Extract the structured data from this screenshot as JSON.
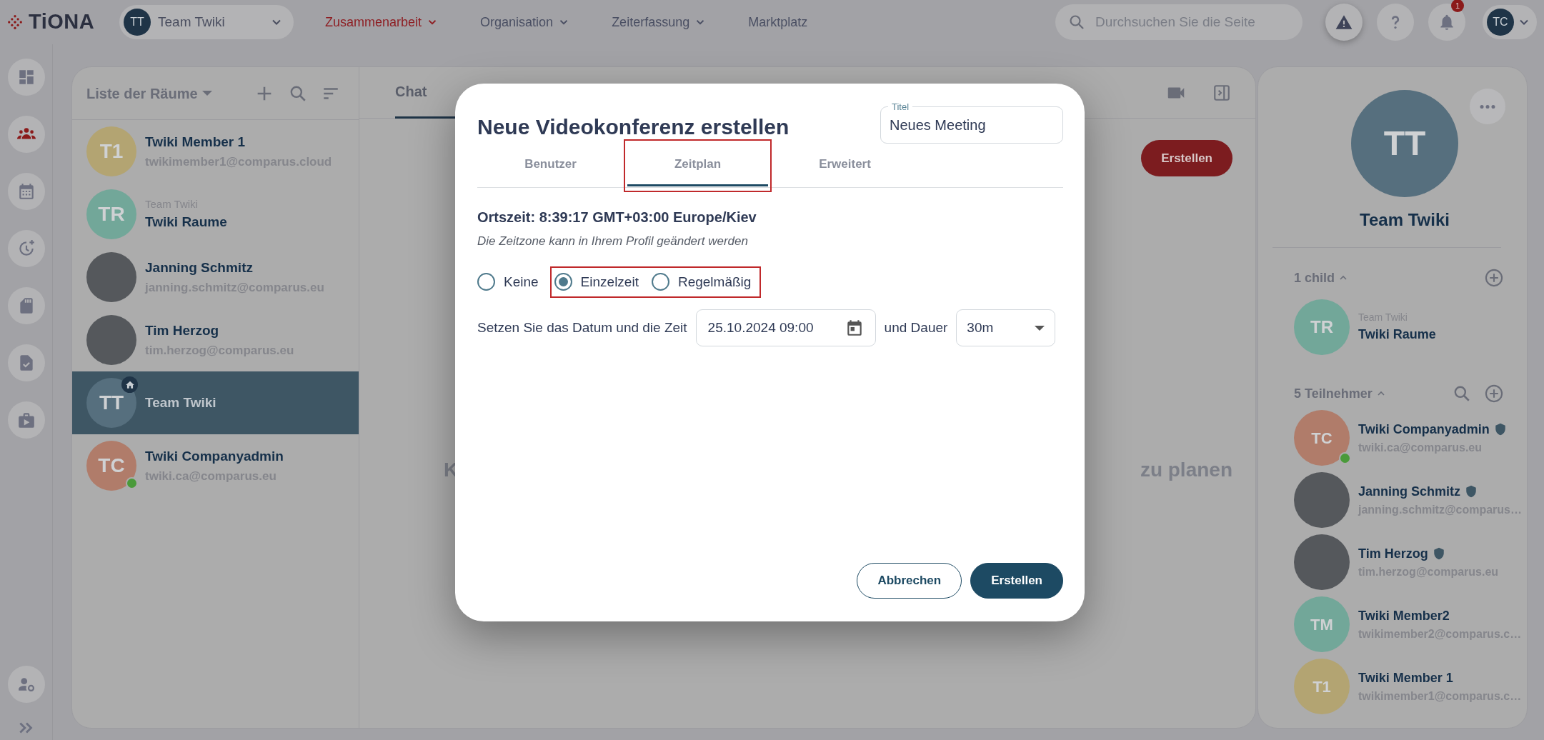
{
  "top_bar": {
    "logo": "TiONA",
    "team_selector": {
      "initials": "TT",
      "name": "Team Twiki"
    },
    "nav": [
      {
        "label": "Zusammenarbeit",
        "selected": true,
        "dropdown": true
      },
      {
        "label": "Organisation",
        "selected": false,
        "dropdown": true
      },
      {
        "label": "Zeiterfassung",
        "selected": false,
        "dropdown": true
      },
      {
        "label": "Marktplatz",
        "selected": false,
        "dropdown": false
      }
    ],
    "search": {
      "placeholder": "Durchsuchen Sie die Seite"
    },
    "notification_count": "1",
    "user_initials": "TC"
  },
  "sidebar": {
    "items": [
      {
        "kind": "dashboard",
        "selected": false
      },
      {
        "kind": "people",
        "selected": true
      },
      {
        "kind": "calendar",
        "selected": false
      },
      {
        "kind": "clock",
        "selected": false
      },
      {
        "kind": "card",
        "selected": false
      },
      {
        "kind": "document",
        "selected": false
      },
      {
        "kind": "briefcase",
        "selected": false
      }
    ],
    "bottom_items": [
      {
        "kind": "user-settings"
      },
      {
        "kind": "expand"
      }
    ]
  },
  "room_list": {
    "title": "Liste der Räume",
    "rooms": [
      {
        "kind": "initials",
        "initials": "T1",
        "color": "#b3a472",
        "name": "Twiki Member 1",
        "email": "twikimember1@comparus.cloud",
        "selected": false,
        "online": false,
        "home": false
      },
      {
        "kind": "initials",
        "initials": "TR",
        "color": "#72a799",
        "parent": "Team Twiki",
        "name": "Twiki Raume",
        "selected": false,
        "online": false,
        "home": false
      },
      {
        "kind": "photo",
        "name": "Janning Schmitz",
        "email": "janning.schmitz@comparus.eu",
        "selected": false,
        "online": false,
        "home": false
      },
      {
        "kind": "photo",
        "name": "Tim Herzog",
        "email": "tim.herzog@comparus.eu",
        "selected": false,
        "online": false,
        "home": false
      },
      {
        "kind": "initials",
        "initials": "TT",
        "color": "#566f7e",
        "name": "Team Twiki",
        "selected": true,
        "online": false,
        "home": true
      },
      {
        "kind": "initials",
        "initials": "TC",
        "color": "#b07c6a",
        "name": "Twiki Companyadmin",
        "email": "twiki.ca@comparus.eu",
        "selected": false,
        "online": true,
        "home": false
      }
    ]
  },
  "chat": {
    "tabs": [
      {
        "label": "Chat",
        "selected": true
      }
    ],
    "create_button": "Erstellen",
    "empty_text_left": "K",
    "empty_text_right": "zu planen"
  },
  "room_info": {
    "initials": "TT",
    "name": "Team Twiki",
    "children_label": "1 child",
    "children": [
      {
        "kind": "initials",
        "initials": "TR",
        "color": "#72a799",
        "parent": "Team Twiki",
        "name": "Twiki Raume"
      }
    ],
    "members_label": "5 Teilnehmer",
    "members": [
      {
        "kind": "initials",
        "initials": "TC",
        "color": "#b07c6a",
        "name": "Twiki Companyadmin",
        "email": "twiki.ca@comparus.eu",
        "online": true,
        "admin": true
      },
      {
        "kind": "photo",
        "name": "Janning Schmitz",
        "email": "janning.schmitz@comparus…",
        "online": false,
        "admin": true
      },
      {
        "kind": "photo",
        "name": "Tim Herzog",
        "email": "tim.herzog@comparus.eu",
        "online": false,
        "admin": true
      },
      {
        "kind": "initials",
        "initials": "TM",
        "color": "#72a799",
        "name": "Twiki Member2",
        "email": "twikimember2@comparus.c…",
        "online": false,
        "admin": false
      },
      {
        "kind": "initials",
        "initials": "T1",
        "color": "#b3a472",
        "name": "Twiki Member 1",
        "email": "twikimember1@comparus.c…",
        "online": false,
        "admin": false
      }
    ]
  },
  "dialog": {
    "title": "Neue Videokonferenz erstellen",
    "title_field": {
      "label": "Titel",
      "value": "Neues Meeting"
    },
    "tabs": [
      {
        "label": "Benutzer",
        "selected": false,
        "highlighted": false
      },
      {
        "label": "Zeitplan",
        "selected": true,
        "highlighted": true
      },
      {
        "label": "Erweitert",
        "selected": false,
        "highlighted": false
      }
    ],
    "local_time": "Ortszeit: 8:39:17 GMT+03:00 Europe/Kiev",
    "timezone_hint": "Die Zeitzone kann in Ihrem Profil geändert werden",
    "schedule_options": [
      {
        "label": "Keine",
        "selected": false,
        "highlighted": false
      },
      {
        "label": "Einzelzeit",
        "selected": true,
        "highlighted": true
      },
      {
        "label": "Regelmäßig",
        "selected": false,
        "highlighted": true
      }
    ],
    "date_label": "Setzen Sie das Datum und die Zeit",
    "date_value": "25.10.2024 09:00",
    "duration_label": "und Dauer",
    "duration_value": "30m",
    "buttons": [
      {
        "label": "Abbrechen",
        "kind": "outline"
      },
      {
        "label": "Erstellen",
        "kind": "primary"
      }
    ]
  }
}
